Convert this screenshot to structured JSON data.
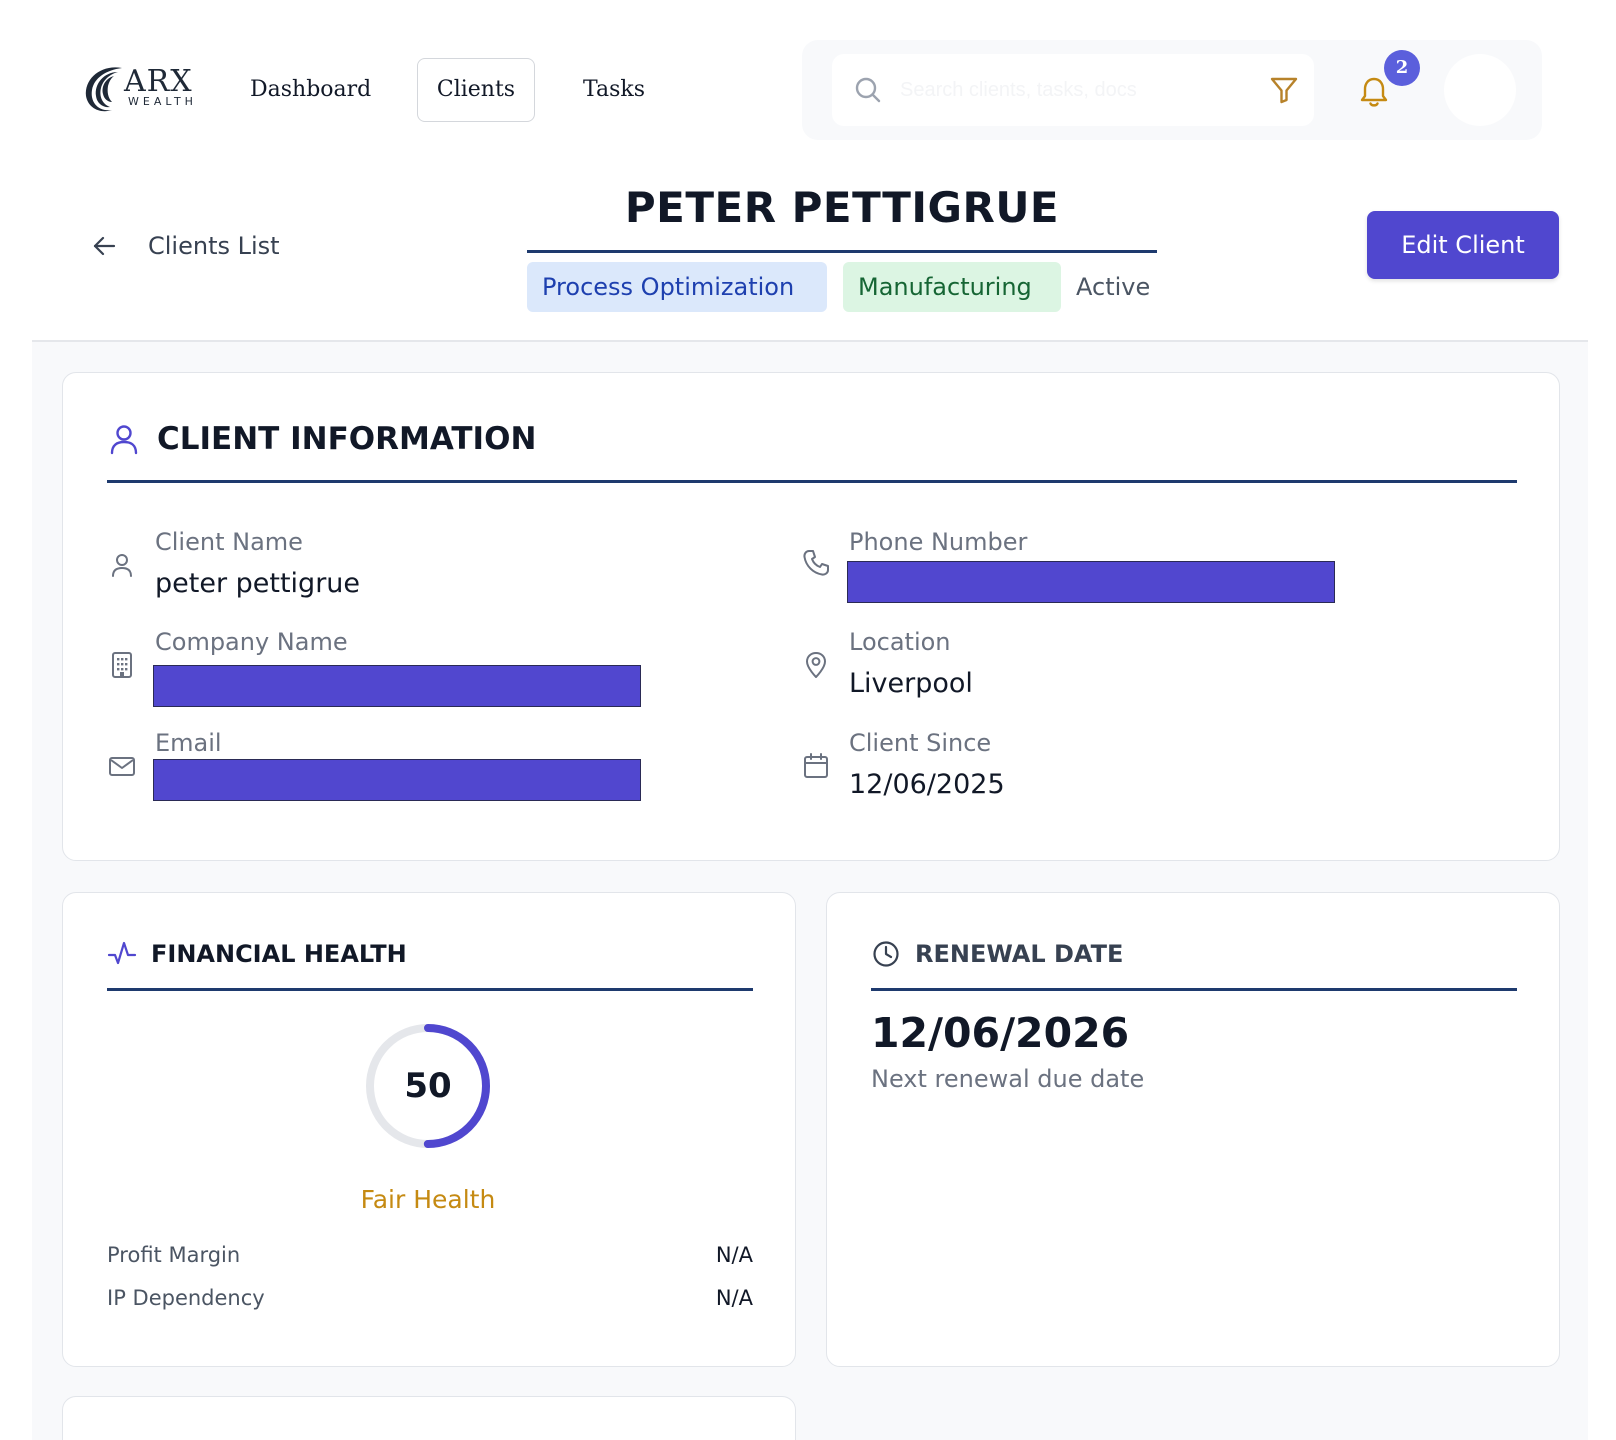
{
  "brand": {
    "logo_word": "ARX",
    "logo_sub": "WEALTH"
  },
  "nav": {
    "items": [
      {
        "label": "Dashboard",
        "active": false
      },
      {
        "label": "Clients",
        "active": true
      },
      {
        "label": "Tasks",
        "active": false
      }
    ]
  },
  "header_tools": {
    "search": {
      "placeholder": "Search clients, tasks, docs",
      "value": ""
    },
    "notifications": {
      "count": "2"
    },
    "icons": {
      "search": "search-icon",
      "filter": "filter-icon",
      "notifications": "bell-icon"
    },
    "colors": {
      "filter": "#b7822a",
      "bell": "#c58a12",
      "badge": "#5b5fdc"
    }
  },
  "client_header": {
    "back_label": "Clients List",
    "name": "PETER PETTIGRUE",
    "tags": [
      {
        "label": "Process Optimization",
        "kind": "service"
      },
      {
        "label": "Manufacturing",
        "kind": "industry"
      },
      {
        "label": "Active",
        "kind": "status"
      }
    ],
    "edit_label": "Edit Client"
  },
  "client_info": {
    "title": "CLIENT INFORMATION",
    "fields": [
      {
        "label": "Client Name",
        "value": "peter pettigrue",
        "redacted": false,
        "icon": "user-icon"
      },
      {
        "label": "Company Name",
        "value": "",
        "redacted": true,
        "icon": "building-icon"
      },
      {
        "label": "Email",
        "value": "",
        "redacted": true,
        "icon": "mail-icon"
      },
      {
        "label": "Phone Number",
        "value": "",
        "redacted": true,
        "icon": "phone-icon"
      },
      {
        "label": "Location",
        "value": "Liverpool",
        "redacted": false,
        "icon": "map-pin-icon"
      },
      {
        "label": "Client Since",
        "value": "12/06/2025",
        "redacted": false,
        "icon": "calendar-icon"
      }
    ]
  },
  "financial_health": {
    "title": "FINANCIAL HEALTH",
    "score": "50",
    "score_max": 100,
    "status": "Fair Health",
    "status_color": "#c58a12",
    "gauge_color": "#5047cf",
    "metrics": [
      {
        "name": "Profit Margin",
        "value": "N/A"
      },
      {
        "name": "IP Dependency",
        "value": "N/A"
      }
    ]
  },
  "renewal": {
    "title": "RENEWAL DATE",
    "date": "12/06/2026",
    "subtitle": "Next renewal due date"
  },
  "theme": {
    "accent": "#5047cf",
    "rule": "#1e3a6e",
    "redaction": "#5147cf"
  }
}
